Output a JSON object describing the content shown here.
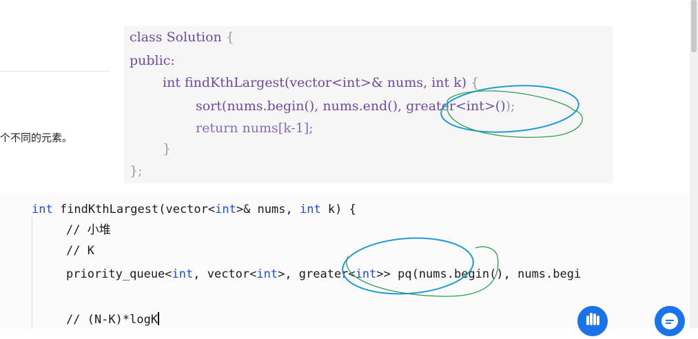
{
  "side_text": "个不同的元素。",
  "top_code": {
    "line1_kw": "class Solution ",
    "line1_brace": "{",
    "line2": "public:",
    "line3_kw": "int findKthLargest(vector",
    "line3_mid": "<int>& nums, int k) ",
    "line3_brace": "{",
    "line4_a": "sort(nums.begin(), nums.end(), ",
    "line4_b": "greater<int>()",
    "line4_c": ");",
    "line5": "return nums[k-1];",
    "line6": "}",
    "line7": "};"
  },
  "bottom_code": {
    "l1_kw": "int",
    "l1_a": " findKthLargest(vector<",
    "l1_kw2": "int",
    "l1_b": ">& nums, ",
    "l1_kw3": "int",
    "l1_c": " k) {",
    "l2": "// 小堆",
    "l3": "// K",
    "l4_a": "priority_queue<",
    "l4_kw1": "int",
    "l4_b": ", vector<",
    "l4_kw2": "int",
    "l4_c": ">, greater<",
    "l4_kw3": "int",
    "l4_d": ">> pq(nums.begin(), nums.begi",
    "l6": "// (N-K)*logK"
  },
  "colors": {
    "annotation_blue": "#1f9ad6",
    "annotation_green": "#2e9b52",
    "keyword": "#1a4fd6",
    "comment": "#2e7d4e"
  },
  "icons": [
    "raise-hand-icon",
    "chat-bubble-icon"
  ]
}
